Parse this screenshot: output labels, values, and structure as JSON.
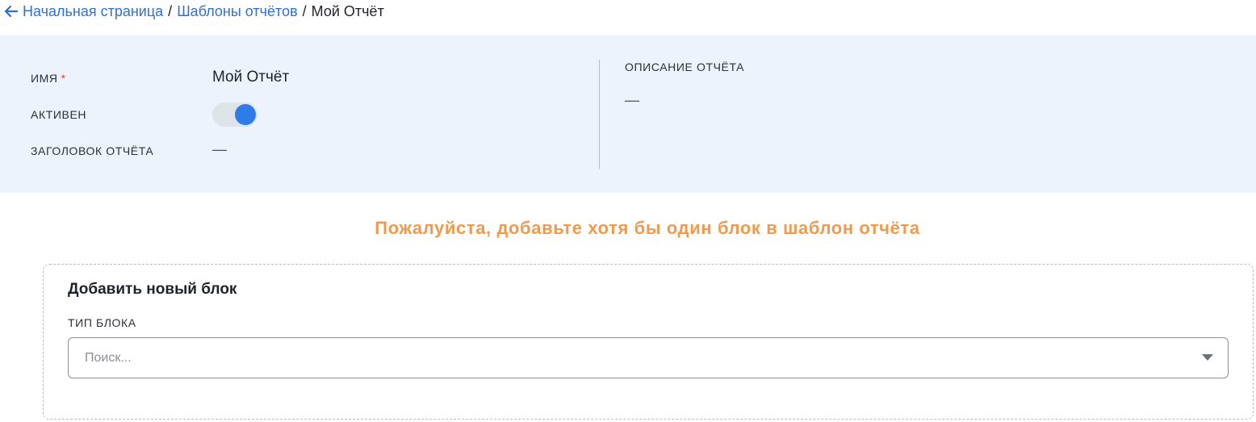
{
  "breadcrumb": {
    "back_icon": "arrow-left-icon",
    "home": "Начальная страница",
    "separator": "/",
    "templates": "Шаблоны отчётов",
    "current": "Мой Отчёт"
  },
  "info": {
    "name_label": "ИМЯ",
    "required_mark": "*",
    "name_value": "Мой Отчёт",
    "active_label": "АКТИВЕН",
    "active_value": true,
    "header_label": "ЗАГОЛОВОК ОТЧЁТА",
    "header_value": "—",
    "description_label": "ОПИСАНИЕ ОТЧЁТА",
    "description_value": "—"
  },
  "warning": "Пожалуйста, добавьте хотя бы один блок в шаблон отчёта",
  "add_block": {
    "title": "Добавить новый блок",
    "type_label": "ТИП БЛОКА",
    "type_placeholder": "Поиск...",
    "type_value": ""
  },
  "colors": {
    "link": "#2f6fd6",
    "panel_bg": "#ecf3fd",
    "toggle_on": "#2f7be8",
    "warning": "#ee9a4f",
    "required": "#e0433a"
  }
}
